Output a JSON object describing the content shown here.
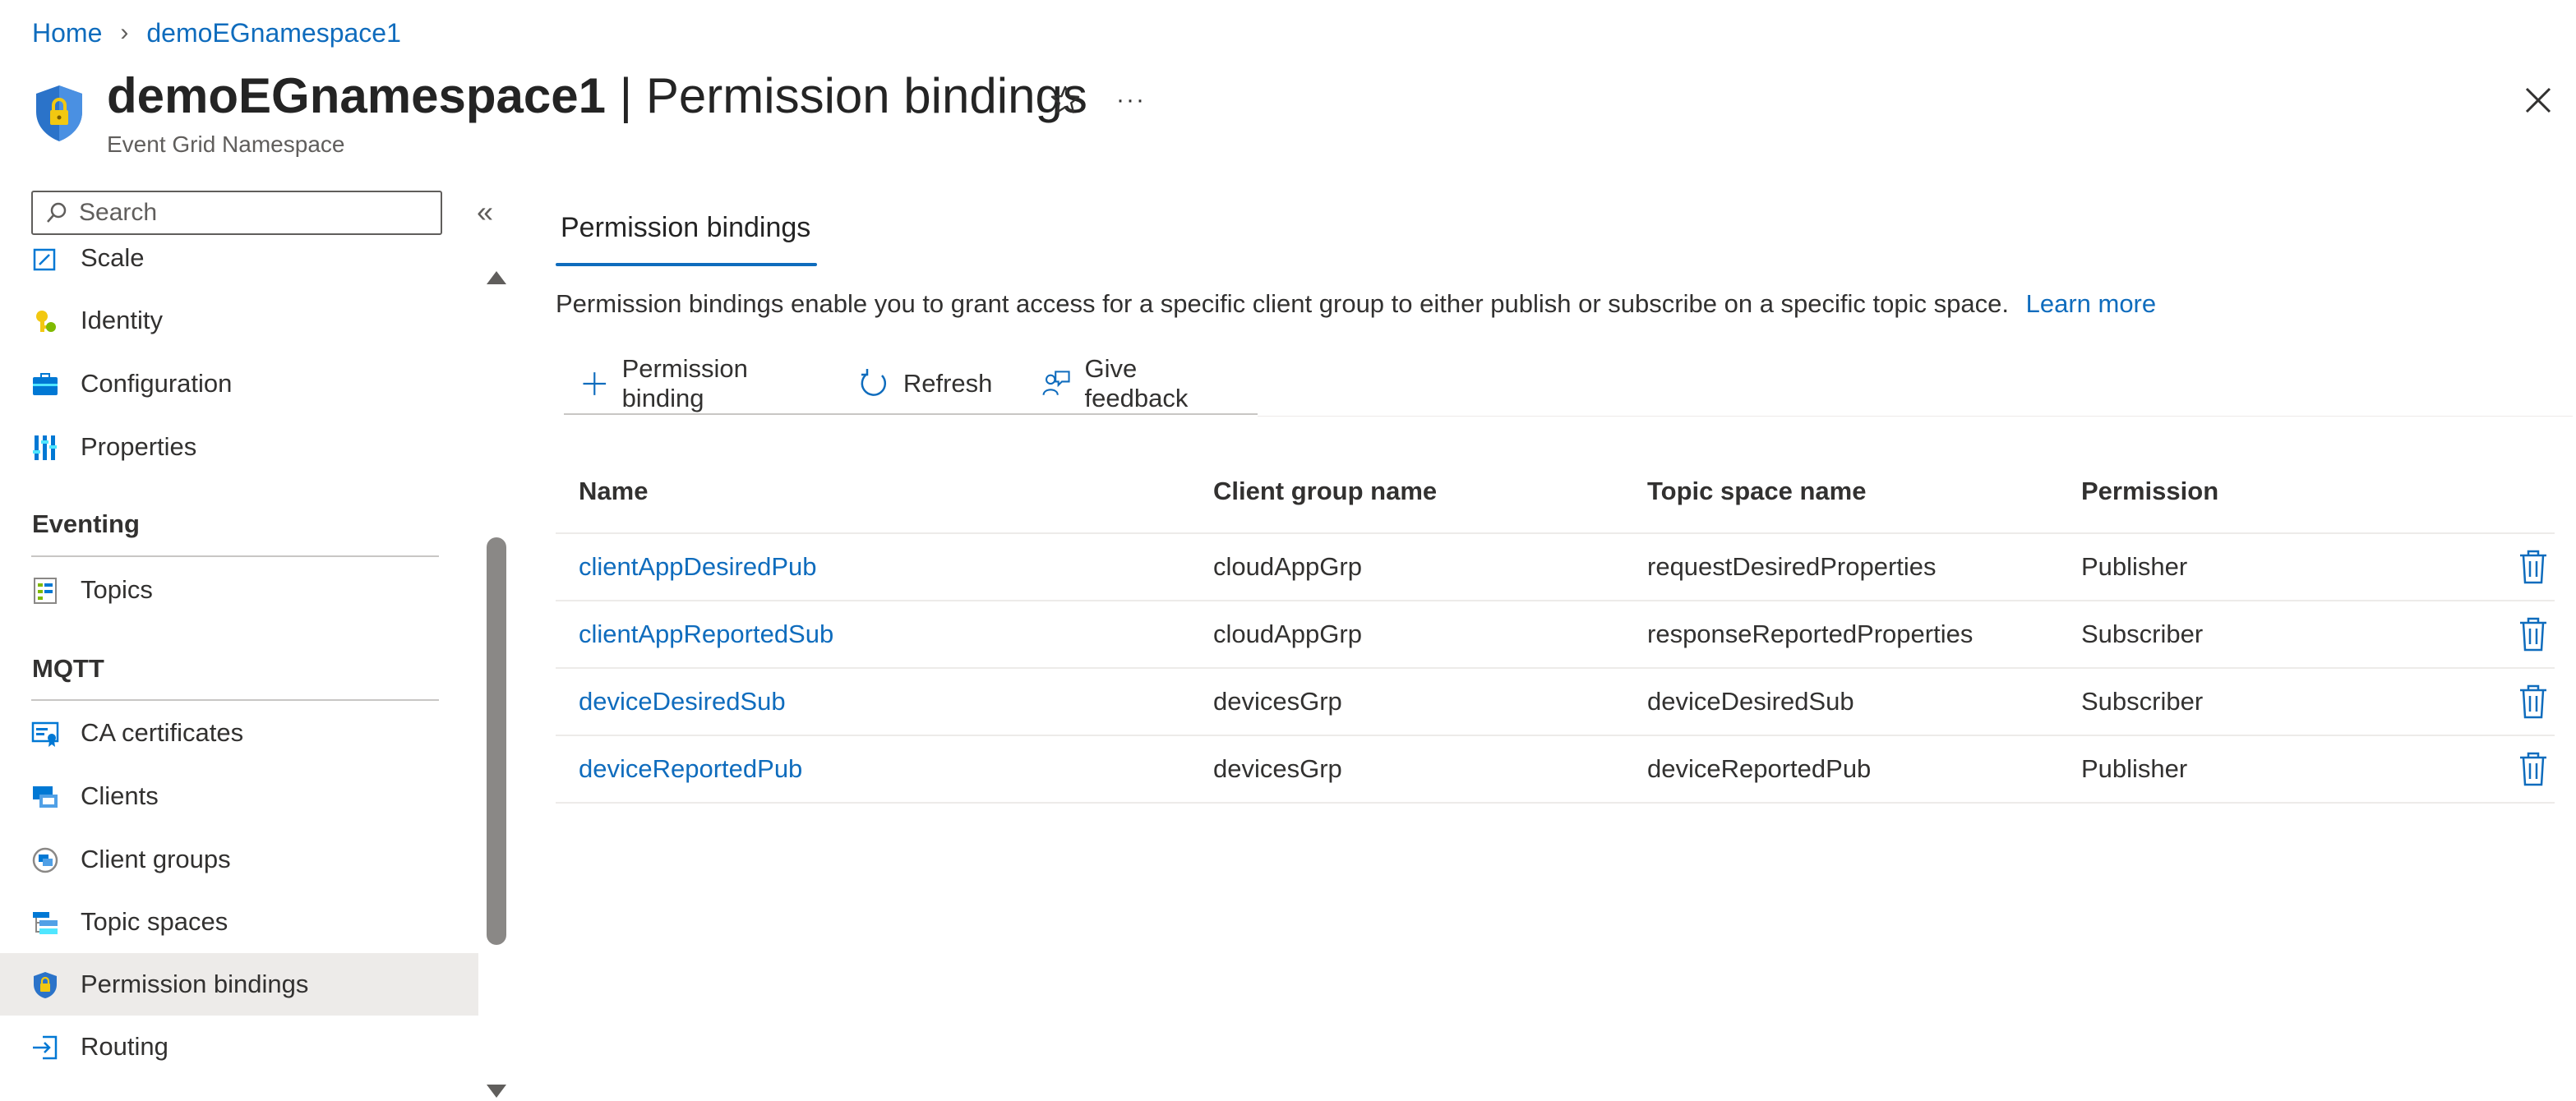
{
  "breadcrumb": {
    "home": "Home",
    "current": "demoEGnamespace1"
  },
  "header": {
    "resource_name": "demoEGnamespace1",
    "separator": " | ",
    "page_name": "Permission bindings",
    "subtitle": "Event Grid Namespace",
    "more_label": "···"
  },
  "search": {
    "placeholder": "Search"
  },
  "collapse_label": "«",
  "nav": {
    "items_top": [
      {
        "label": "Scale",
        "icon": "scale-icon"
      },
      {
        "label": "Identity",
        "icon": "identity-icon"
      },
      {
        "label": "Configuration",
        "icon": "configuration-icon"
      },
      {
        "label": "Properties",
        "icon": "properties-icon"
      }
    ],
    "group_eventing": "Eventing",
    "items_eventing": [
      {
        "label": "Topics",
        "icon": "topics-icon"
      }
    ],
    "group_mqtt": "MQTT",
    "items_mqtt": [
      {
        "label": "CA certificates",
        "icon": "ca-certificate-icon"
      },
      {
        "label": "Clients",
        "icon": "clients-icon"
      },
      {
        "label": "Client groups",
        "icon": "client-groups-icon"
      },
      {
        "label": "Topic spaces",
        "icon": "topic-spaces-icon"
      },
      {
        "label": "Permission bindings",
        "icon": "shield-lock-icon",
        "selected": true
      },
      {
        "label": "Routing",
        "icon": "routing-icon"
      }
    ]
  },
  "main": {
    "tab_label": "Permission bindings",
    "description": "Permission bindings enable you to grant access for a specific client group to either publish or subscribe on a specific topic space.",
    "learn_more": "Learn more",
    "toolbar": {
      "add_label": "Permission binding",
      "refresh_label": "Refresh",
      "feedback_label": "Give feedback"
    },
    "table": {
      "columns": [
        "Name",
        "Client group name",
        "Topic space name",
        "Permission"
      ],
      "rows": [
        {
          "name": "clientAppDesiredPub",
          "client_group": "cloudAppGrp",
          "topic_space": "requestDesiredProperties",
          "permission": "Publisher"
        },
        {
          "name": "clientAppReportedSub",
          "client_group": "cloudAppGrp",
          "topic_space": "responseReportedProperties",
          "permission": "Subscriber"
        },
        {
          "name": "deviceDesiredSub",
          "client_group": "devicesGrp",
          "topic_space": "deviceDesiredSub",
          "permission": "Subscriber"
        },
        {
          "name": "deviceReportedPub",
          "client_group": "devicesGrp",
          "topic_space": "deviceReportedPub",
          "permission": "Publisher"
        }
      ]
    }
  },
  "colors": {
    "accent": "#0f6cbd",
    "selected_bg": "#edebe9",
    "text": "#323130",
    "muted": "#605e5c"
  }
}
